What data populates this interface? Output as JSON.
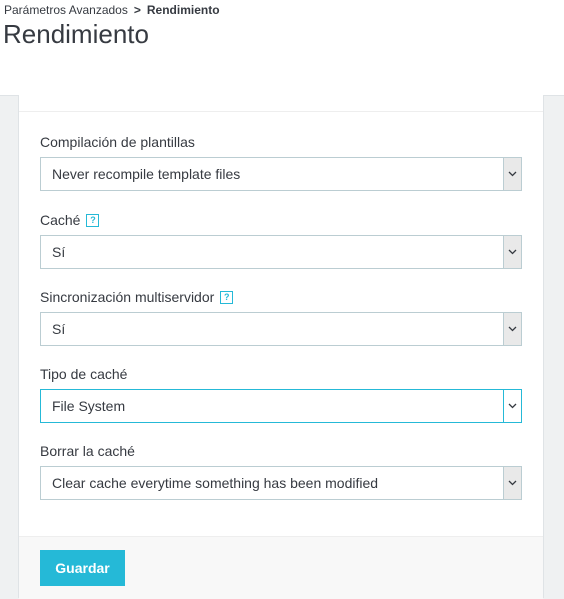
{
  "breadcrumb": {
    "parent": "Parámetros Avanzados",
    "separator": ">",
    "current": "Rendimiento"
  },
  "page_title": "Rendimiento",
  "form": {
    "template_compilation": {
      "label": "Compilación de plantillas",
      "value": "Never recompile template files"
    },
    "cache": {
      "label": "Caché",
      "help": "?",
      "value": "Sí"
    },
    "multi_server_sync": {
      "label": "Sincronización multiservidor",
      "help": "?",
      "value": "Sí"
    },
    "cache_type": {
      "label": "Tipo de caché",
      "value": "File System",
      "focused": true
    },
    "clear_cache": {
      "label": "Borrar la caché",
      "value": "Clear cache everytime something has been modified"
    }
  },
  "footer": {
    "save_label": "Guardar"
  },
  "colors": {
    "accent": "#25b9d7",
    "text": "#363a41",
    "border": "#bbcdd2",
    "background": "#eff1f2"
  },
  "icons": {
    "select_arrow": "chevron-down-icon",
    "help": "help-icon"
  }
}
